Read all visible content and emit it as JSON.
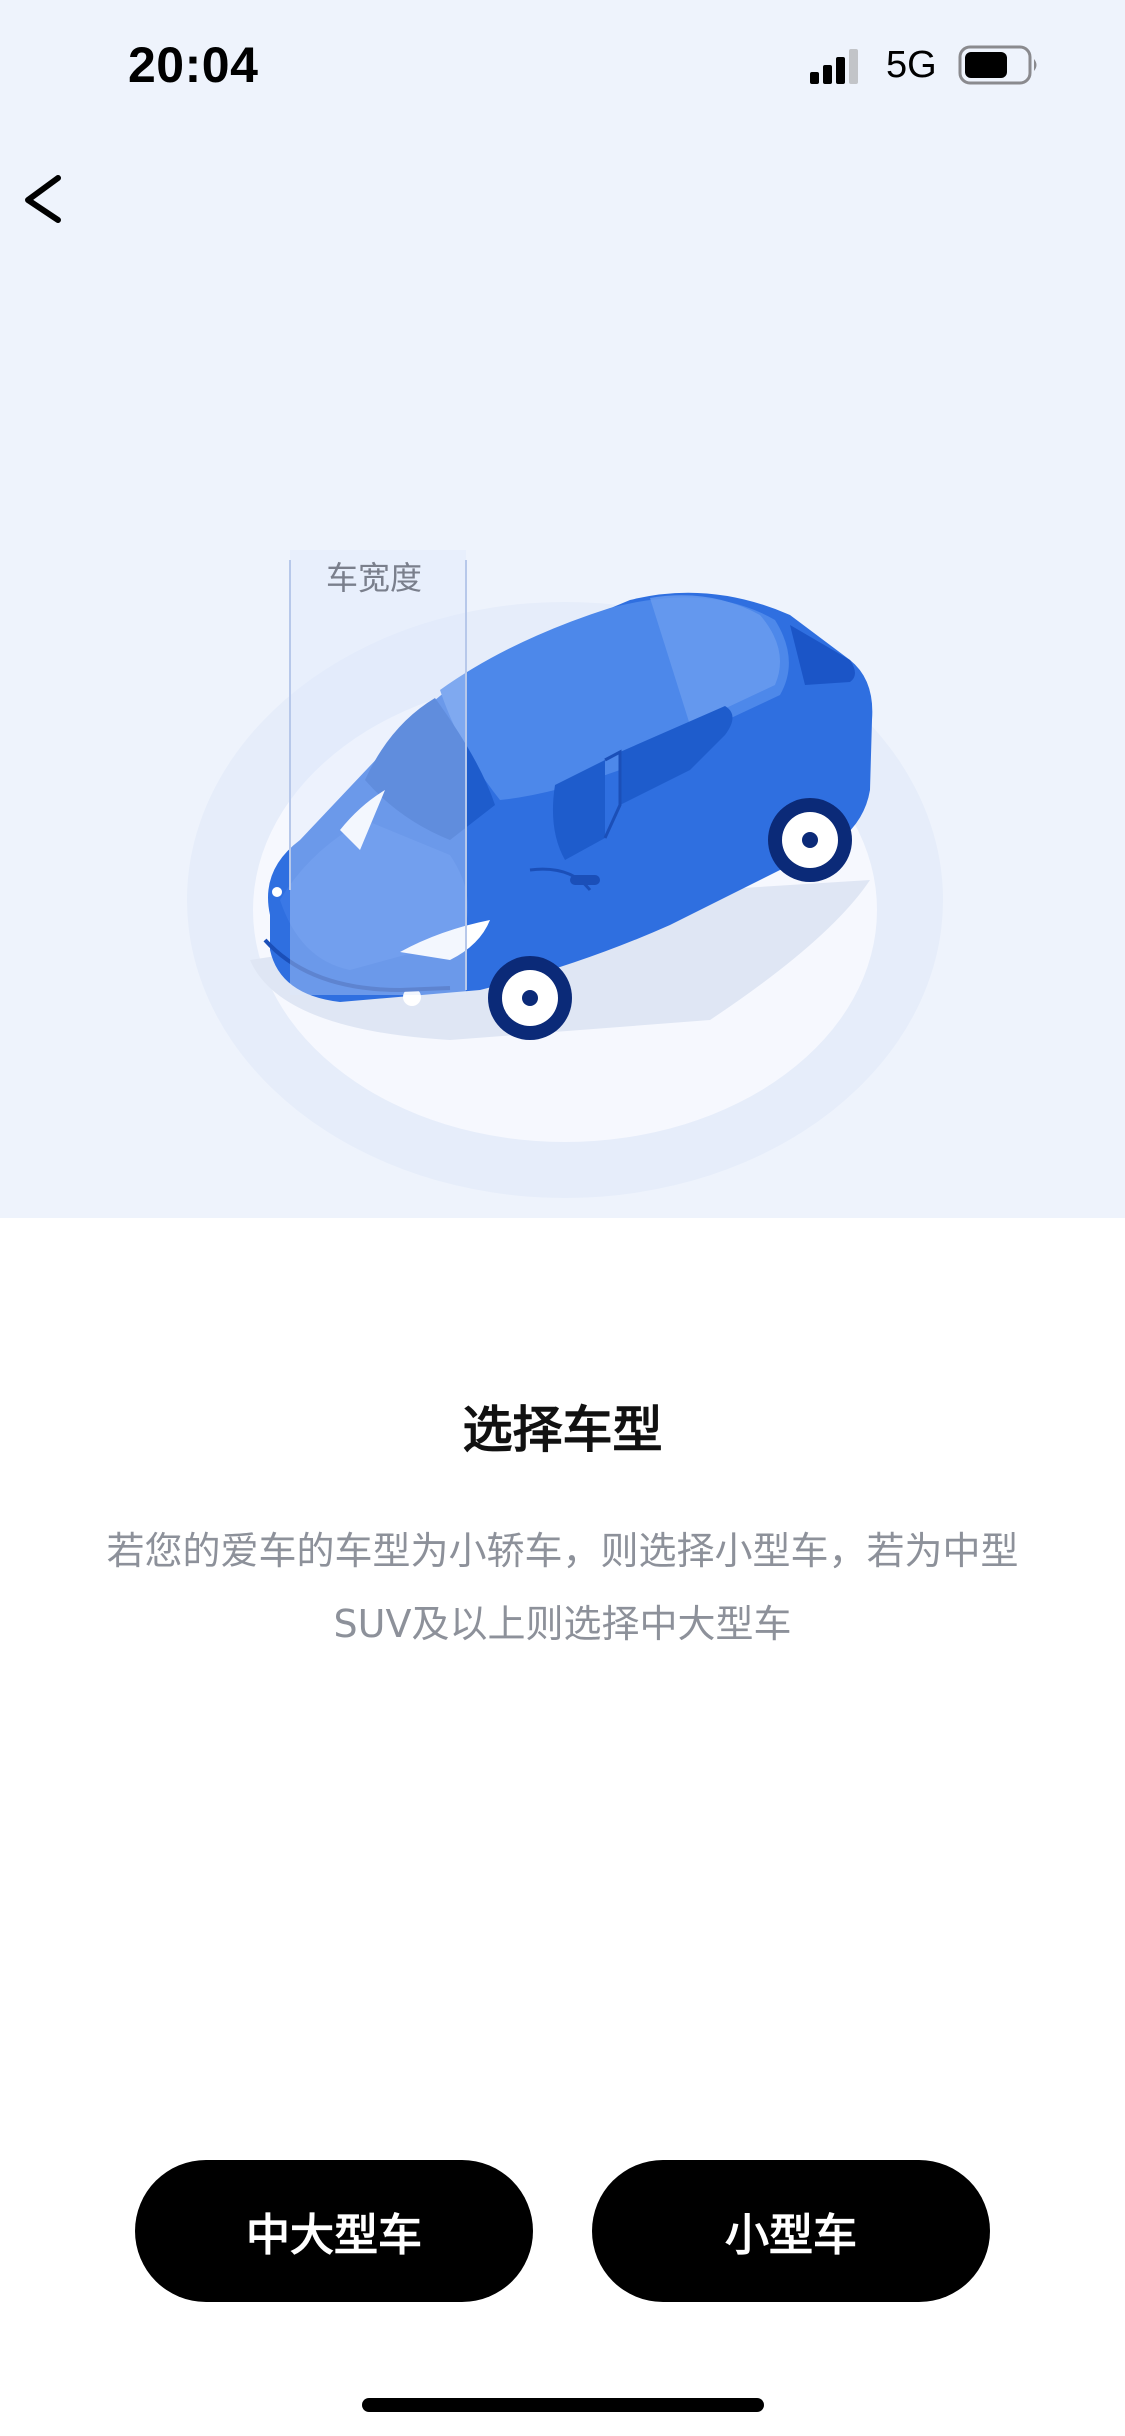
{
  "status_bar": {
    "time": "20:04",
    "network": "5G",
    "signal_icon": "signal-bars-icon",
    "battery_icon": "battery-icon"
  },
  "nav": {
    "back_icon": "chevron-left-icon"
  },
  "illustration": {
    "label": "车宽度",
    "accent_color": "#2f6fe0"
  },
  "content": {
    "title": "选择车型",
    "description": "若您的爱车的车型为小轿车，则选择小型车，若为中型SUV及以上则选择中大型车"
  },
  "actions": {
    "large_label": "中大型车",
    "small_label": "小型车"
  },
  "colors": {
    "hero_background": "#eef3fc",
    "button_background": "#000000",
    "button_text": "#ffffff"
  }
}
